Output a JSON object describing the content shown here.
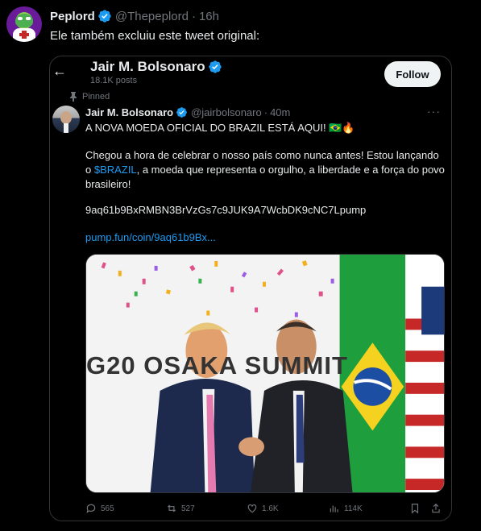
{
  "outer_post": {
    "author_name": "Peplord",
    "handle": "@Thepeplord",
    "time": "16h",
    "separator": "·",
    "text": "Ele também excluiu este tweet original:"
  },
  "embedded": {
    "profile_name": "Jair M. Bolsonaro",
    "posts_count": "18.1K posts",
    "follow_label": "Follow",
    "pinned_label": "Pinned",
    "tweet": {
      "author_name": "Jair M. Bolsonaro",
      "handle": "@jairbolsonaro",
      "time": "40m",
      "separator": "·",
      "line1": "A NOVA MOEDA OFICIAL DO BRAZIL ESTÁ AQUI! 🇧🇷🔥",
      "line2_before": "Chegou a hora de celebrar o nosso país como nunca antes! Estou lançando o ",
      "cashtag": "$BRAZIL",
      "line2_after": ", a moeda que representa o orgulho, a liberdade e a força do povo brasileiro!",
      "contract": "9aq61b9BxRMBN3BrVzGs7c9JUK9A7WcbDK9cNC7Lpump",
      "link": "pump.fun/coin/9aq61b9Bx...",
      "photo_banner": "G20 OSAKA SUMMIT",
      "replies": "565",
      "reposts": "527",
      "likes": "1.6K",
      "views": "114K"
    }
  },
  "colors": {
    "background": "#000000",
    "text": "#e7e9ea",
    "muted": "#71767b",
    "accent": "#1d9bf0",
    "follow_bg": "#eff3f4"
  },
  "icons": [
    "back-arrow-icon",
    "verified-badge-icon",
    "pin-icon",
    "more-icon",
    "reply-icon",
    "repost-icon",
    "like-icon",
    "views-icon",
    "bookmark-icon",
    "share-icon"
  ]
}
